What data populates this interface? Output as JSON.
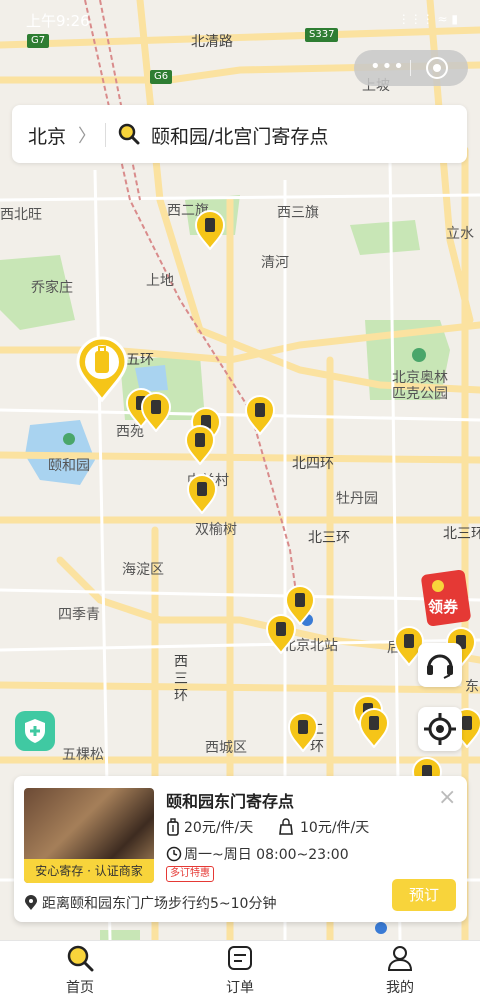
{
  "status_bar": {
    "time": "上午9:26",
    "icons": "⋮⋮⋮ ≈ ▮"
  },
  "search": {
    "city": "北京",
    "city_arrow": "〉",
    "query": "颐和园/北宫门寄存点"
  },
  "map_labels": {
    "north_qingroad": "北清路",
    "shangpo": "上坡",
    "xibeiwang": "西北旺",
    "xierqi": "西二旗",
    "xisanqi": "西三旗",
    "liwaterwater": "立水",
    "qinghe": "清河",
    "shangdi": "上地",
    "qiaojiazhuang": "乔家庄",
    "wuhuan": "五环",
    "olympic_park": "北京奥林\n匹克公园",
    "xiyuan": "西苑",
    "yiheyuan": "颐和园",
    "beisihuan": "北四环",
    "zhongguancun": "中关村",
    "mudanyuan": "牡丹园",
    "shuangyushu": "双榆树",
    "beisanhuan": "北三环",
    "beisanhuan_right": "北三环",
    "haidianqu": "海淀区",
    "sijiqing": "四季青",
    "beijing_north": "北京北站",
    "xisanhuan": "西\n三\n环",
    "dong": "东",
    "wukesong": "五棵松",
    "xichengqu": "西城区",
    "ersanhuan": "二\n环",
    "hou": "后"
  },
  "shields": {
    "g7": "G7",
    "s337": "S337",
    "g6": "G6"
  },
  "coupon": {
    "label": "领券"
  },
  "card": {
    "title": "颐和园东门寄存点",
    "img_ribbon": "安心寄存 · 认证商家",
    "price_luggage": "20元/件/天",
    "price_bag": "10元/件/天",
    "hours": "周一~周日 08:00~23:00",
    "promo": "多订特惠",
    "distance": "距离颐和园东门广场步行约5~10分钟",
    "book": "预订",
    "close": "×"
  },
  "tabs": [
    {
      "label": "首页"
    },
    {
      "label": "订单"
    },
    {
      "label": "我的"
    }
  ],
  "colors": {
    "accent": "#f8d43b",
    "pin": "#f5c518",
    "map_bg": "#f2efe9",
    "road": "#fbe2a0",
    "park": "#c8e6b6",
    "water": "#a9d3f0"
  }
}
